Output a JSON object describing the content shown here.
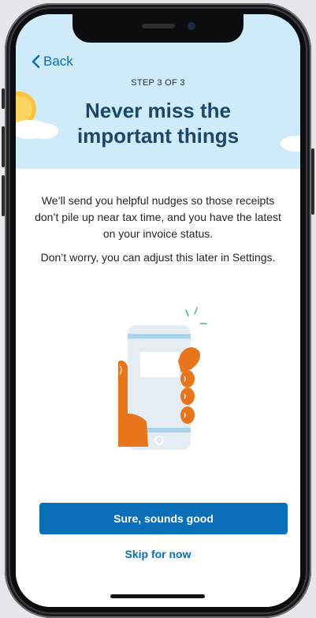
{
  "nav": {
    "back_label": "Back"
  },
  "header": {
    "step_label": "STEP 3 OF 3",
    "title_line1": "Never miss the",
    "title_line2": "important things"
  },
  "content": {
    "paragraph1": "We’ll send you helpful nudges so those receipts don’t pile up near tax time, and you have the latest on your invoice status.",
    "paragraph2": "Don’t worry, you can adjust this later in Settings."
  },
  "actions": {
    "primary_label": "Sure, sounds good",
    "secondary_label": "Skip for now"
  },
  "colors": {
    "accent": "#0a6eb8",
    "title": "#1d4766",
    "sky": "#cfeaf8",
    "illustration_orange": "#e8741c"
  }
}
